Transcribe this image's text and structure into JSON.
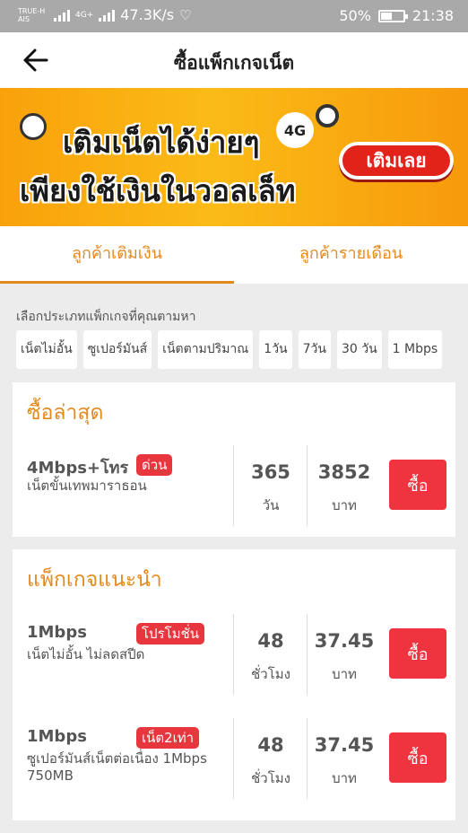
{
  "statusbar": {
    "carrier": "TRUE-H AIS",
    "network": "4G+",
    "speed": "47.3K/s",
    "battery": "50%",
    "battery_level": 0.5,
    "time": "21:38"
  },
  "header": {
    "title": "ซื้อแพ็กเกจเน็ต",
    "back_icon": "arrow-left-icon"
  },
  "banner": {
    "line1": "เติมเน็ตได้ง่ายๆ",
    "line2": "เพียงใช้เงินในวอลเล็ท",
    "badge": "4G",
    "button_label": "เติมเลย",
    "colors": {
      "bg": "#f9a10b",
      "button": "#e2231a"
    }
  },
  "tabs": [
    {
      "label": "ลูกค้าเติมเงิน",
      "active": true
    },
    {
      "label": "ลูกค้ารายเดือน",
      "active": false
    }
  ],
  "filters": {
    "label": "เลือกประเภทแพ็กเกจที่คุณตามหา",
    "chips": [
      "เน็ตไม่อั้น",
      "ซูเปอร์มันส์",
      "เน็ตตามปริมาณ",
      "1วัน",
      "7วัน",
      "30 วัน",
      "1 Mbps"
    ]
  },
  "recent": {
    "title": "ซื้อล่าสุด",
    "items": [
      {
        "name": "4Mbps+โทร",
        "tag": "ด่วน",
        "desc": "เน็ตขั้นเทพมาราธอน",
        "duration": "365",
        "duration_unit": "วัน",
        "price": "3852",
        "price_unit": "บาท",
        "buy_label": "ซื้อ"
      }
    ]
  },
  "recommended": {
    "title": "แพ็กเกจแนะนำ",
    "items": [
      {
        "name": "1Mbps",
        "tag": "โปรโมชั่น",
        "desc": "เน็ตไม่อั้น ไม่ลดสปีด",
        "duration": "48",
        "duration_unit": "ชั่วโมง",
        "price": "37.45",
        "price_unit": "บาท",
        "buy_label": "ซื้อ"
      },
      {
        "name": "1Mbps",
        "tag": "เน็ต2เท่า",
        "desc": "ซูเปอร์มันส์เน็ตต่อเนื่อง 1Mbps 750MB",
        "duration": "48",
        "duration_unit": "ชั่วโมง",
        "price": "37.45",
        "price_unit": "บาท",
        "buy_label": "ซื้อ"
      }
    ]
  },
  "colors": {
    "accent": "#e38a1f",
    "buy": "#f0343f",
    "tag": "#e8363e"
  }
}
